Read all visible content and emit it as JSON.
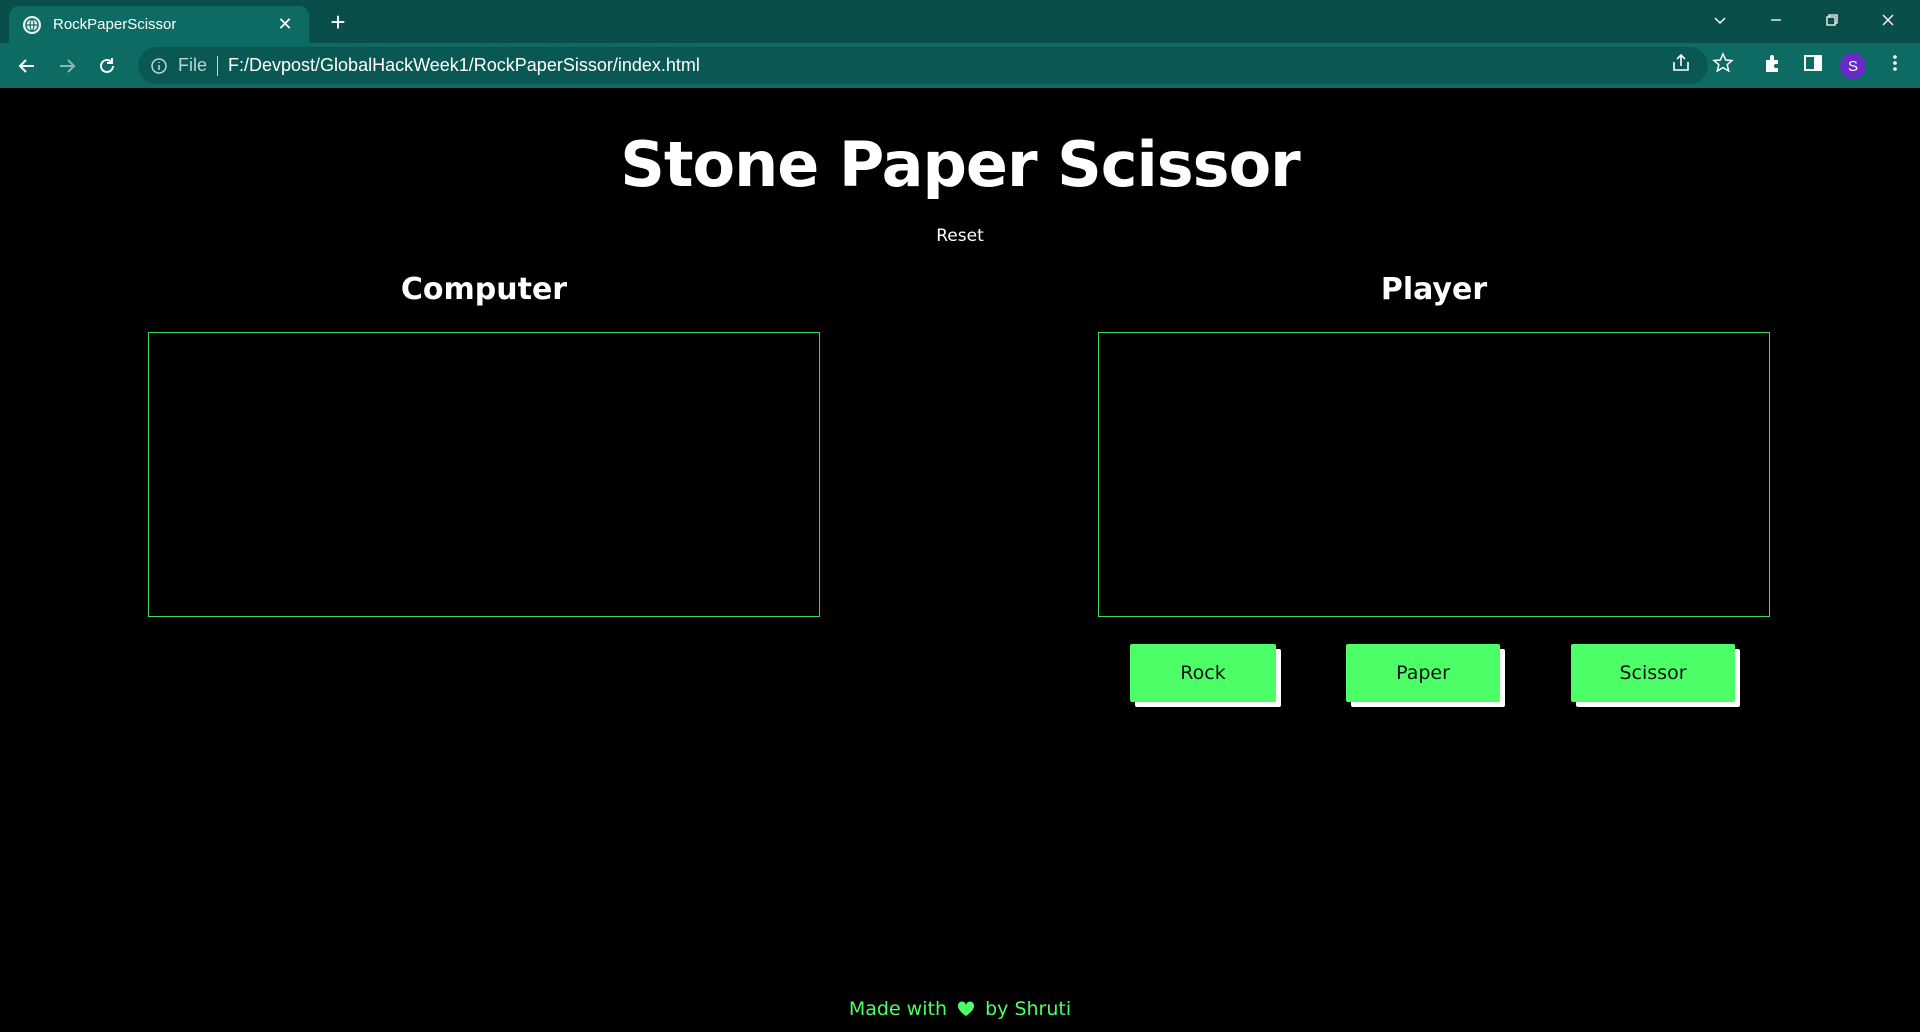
{
  "browser": {
    "tab_title": "RockPaperScissor",
    "new_tab_icon": "plus-icon",
    "address": {
      "scheme": "File",
      "url": "F:/Devpost/GlobalHackWeek1/RockPaperSissor/index.html"
    },
    "profile_initial": "S",
    "profile_color": "#6a2ac8"
  },
  "page": {
    "title": "Stone Paper Scissor",
    "reset_label": "Reset",
    "computer": {
      "heading": "Computer"
    },
    "player": {
      "heading": "Player"
    },
    "choices": [
      {
        "label": "Rock"
      },
      {
        "label": "Paper"
      },
      {
        "label": "Scissor"
      }
    ],
    "footer": {
      "prefix": "Made with",
      "suffix": "by Shruti"
    }
  },
  "colors": {
    "accent": "#4cff66",
    "border": "#3cd85a",
    "background": "#000000",
    "chrome": "#0d6b63"
  }
}
